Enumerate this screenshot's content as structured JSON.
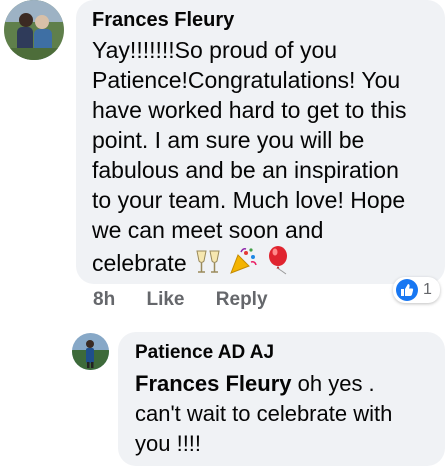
{
  "comment": {
    "author": "Frances Fleury",
    "lines": [
      "Yay!!!!!!!So proud of you",
      "Patience!Congratulations! You",
      "have worked hard to get to this",
      "point. I am sure you will be",
      "fabulous and be an inspiration",
      "to your team. Much love! Hope",
      "we can meet soon and",
      "celebrate"
    ],
    "emojis": [
      "champagne-icon",
      "party-popper-icon",
      "balloon-icon"
    ],
    "time": "8h",
    "like_label": "Like",
    "reply_label": "Reply",
    "reaction_count": "1"
  },
  "reply": {
    "author": "Patience AD AJ",
    "mention": "Frances Fleury",
    "text_rest": " oh yes .",
    "lines": [
      "can't wait to celebrate with",
      "you !!!!"
    ]
  },
  "colors": {
    "bubble": "#f0f2f5",
    "meta": "#65676b",
    "like_blue": "#1877f2"
  }
}
